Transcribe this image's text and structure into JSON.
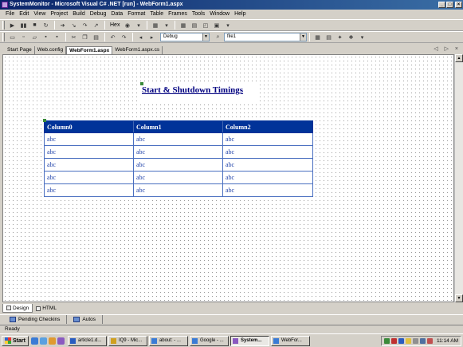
{
  "window": {
    "title": "SystemMonitor - Microsoft Visual C# .NET [run] - WebForm1.aspx",
    "min_label": "_",
    "max_label": "□",
    "close_label": "×"
  },
  "menu": [
    "File",
    "Edit",
    "View",
    "Project",
    "Build",
    "Debug",
    "Data",
    "Format",
    "Table",
    "Frames",
    "Tools",
    "Window",
    "Help"
  ],
  "toolbar1": {
    "hex_label": "Hex"
  },
  "toolbar2": {
    "config_value": "Debug",
    "target_value": "file1"
  },
  "doc_tabs": [
    "Start Page",
    "Web.config",
    "WebForm1.aspx",
    "WebForm1.aspx.cs"
  ],
  "tab_nav": "◁ ▷ ×",
  "page": {
    "heading": "Start & Shutdown Timings",
    "grid": {
      "columns": [
        "Column0",
        "Column1",
        "Column2"
      ],
      "rows": [
        [
          "abc",
          "abc",
          "abc"
        ],
        [
          "abc",
          "abc",
          "abc"
        ],
        [
          "abc",
          "abc",
          "abc"
        ],
        [
          "abc",
          "abc",
          "abc"
        ],
        [
          "abc",
          "abc",
          "abc"
        ]
      ]
    }
  },
  "view_tabs": [
    "Design",
    "HTML"
  ],
  "panels": [
    "Pending Checkins",
    "Autos"
  ],
  "status": "Ready",
  "taskbar": {
    "start_label": "Start",
    "tasks": [
      "article1.d...",
      "IQ9 - Mic...",
      "about: - ...",
      "Google - ...",
      "System...",
      "WebFor..."
    ],
    "clock": "11:14 AM"
  },
  "colors": {
    "titlebar": "#0a246a",
    "grid_header": "#003399",
    "heading": "#000080"
  }
}
